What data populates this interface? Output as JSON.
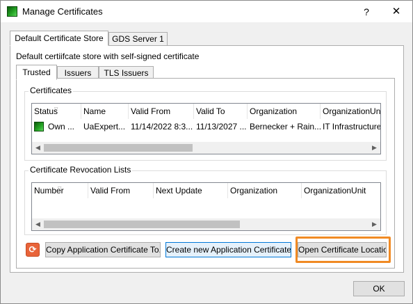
{
  "window": {
    "title": "Manage Certificates",
    "help": "?",
    "close": "✕"
  },
  "outer_tabs": [
    {
      "label": "Default Certificate Store"
    },
    {
      "label": "GDS Server 1"
    }
  ],
  "store_description": "Default certiifcate store with self-signed certificate",
  "inner_tabs": [
    {
      "label": "Trusted"
    },
    {
      "label": "Issuers"
    },
    {
      "label": "TLS Issuers"
    }
  ],
  "certificates": {
    "group_label": "Certificates",
    "columns": [
      "Status",
      "Name",
      "Valid From",
      "Valid To",
      "Organization",
      "OrganizationUnit"
    ],
    "rows": [
      {
        "status": "Own ...",
        "name": "UaExpert...",
        "valid_from": "11/14/2022 8:3...",
        "valid_to": "11/13/2027 ...",
        "organization": "Bernecker + Rain...",
        "organization_unit": "IT Infrastructure"
      }
    ]
  },
  "crl": {
    "group_label": "Certificate Revocation Lists",
    "columns": [
      "Number",
      "Valid From",
      "Next Update",
      "Organization",
      "OrganizationUnit"
    ]
  },
  "buttons": {
    "refresh_icon": "⟳",
    "copy": "Copy Application Certificate To...",
    "create": "Create new Application Certificate...",
    "open_location": "Open Certificate Location",
    "ok": "OK"
  },
  "icons": {
    "app": "certificate-icon",
    "refresh": "refresh-icon"
  },
  "colors": {
    "highlight": "#f08a24",
    "focus_border": "#0078d7",
    "refresh_bg": "#e8643a"
  }
}
